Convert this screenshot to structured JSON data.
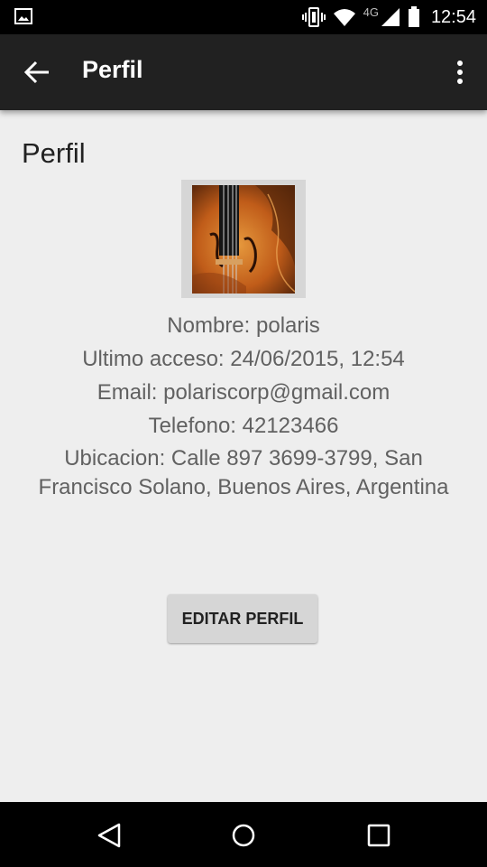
{
  "status_bar": {
    "time": "12:54",
    "network": "4G",
    "icons": [
      "gallery-notification-icon",
      "vibrate-icon",
      "wifi-icon",
      "cell-signal-icon",
      "battery-icon"
    ]
  },
  "app_bar": {
    "title": "Perfil",
    "icons": [
      "back-arrow-icon",
      "overflow-menu-icon"
    ]
  },
  "content": {
    "heading": "Perfil",
    "avatar": "violin-image",
    "nombre": "Nombre: polaris",
    "ultimo_acceso": "Ultimo acceso: 24/06/2015, 12:54",
    "email": "Email: polariscorp@gmail.com",
    "telefono": "Telefono: 42123466",
    "ubicacion": "Ubicacion: Calle 897 3699-3799, San Francisco Solano, Buenos Aires, Argentina",
    "edit_button_label": "EDITAR PERFIL"
  },
  "nav_bar": {
    "icons": [
      "nav-back-icon",
      "nav-home-icon",
      "nav-recents-icon"
    ]
  },
  "colors": {
    "app_bar": "#212121",
    "background": "#eeeeee",
    "text_secondary": "#616161",
    "button": "#d6d6d6"
  }
}
